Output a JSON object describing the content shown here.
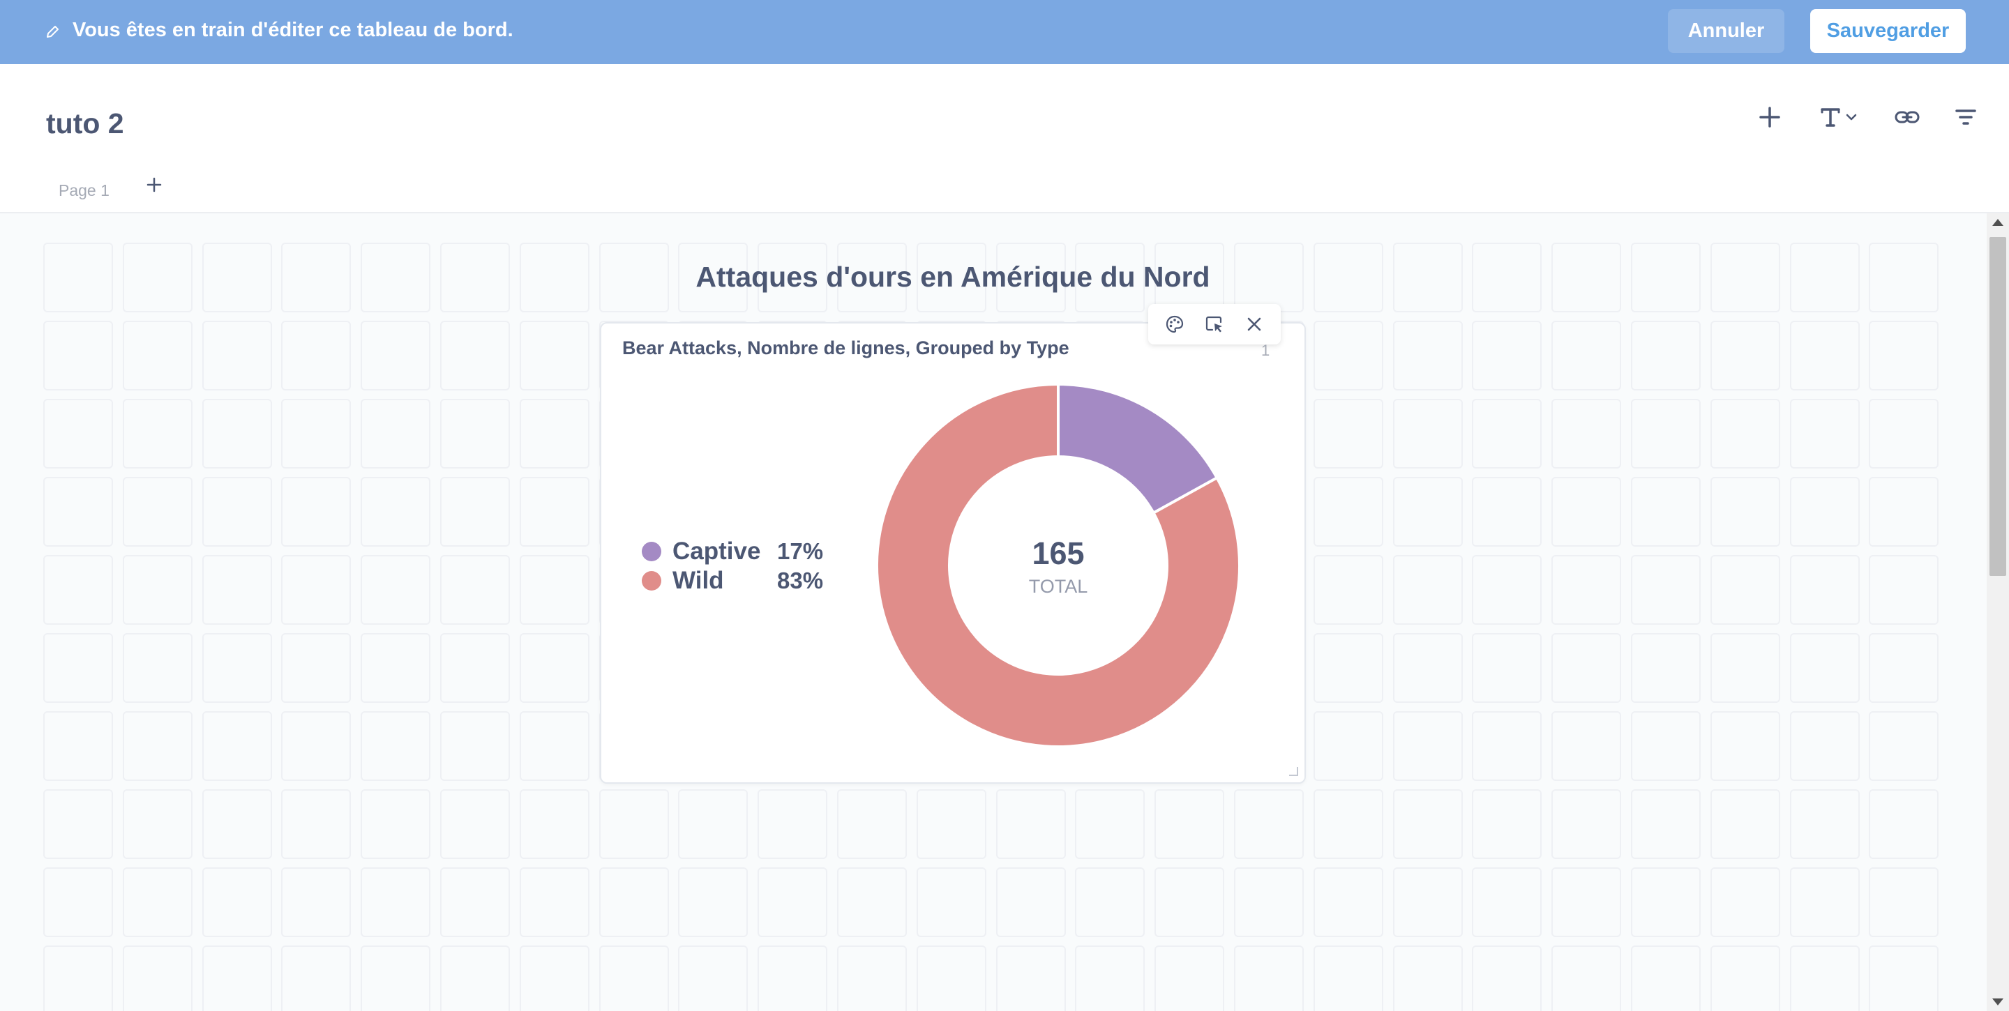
{
  "edit_banner": {
    "message": "Vous êtes en train d'éditer ce tableau de bord.",
    "cancel_label": "Annuler",
    "save_label": "Sauvegarder",
    "background_color": "#7ba8e2",
    "icon": "pencil-icon"
  },
  "header": {
    "title": "tuto 2",
    "tools": [
      {
        "name": "add-question-button",
        "icon": "plus-icon"
      },
      {
        "name": "add-text-button",
        "icon": "text-icon"
      },
      {
        "name": "add-link-button",
        "icon": "link-icon"
      },
      {
        "name": "add-filter-button",
        "icon": "filter-icon"
      }
    ],
    "tabs": [
      {
        "label": "Page 1"
      }
    ],
    "add_tab_icon": "plus-icon"
  },
  "dashboard": {
    "heading": "Attaques d'ours en Amérique du Nord",
    "card": {
      "title": "Bear Attacks, Nombre de lignes, Grouped by Type",
      "badge": "1",
      "actions": [
        "palette-icon",
        "replace-icon",
        "close-icon"
      ],
      "total_value": "165",
      "total_label": "TOTAL",
      "legend": [
        {
          "name": "Captive",
          "percent": "17%"
        },
        {
          "name": "Wild",
          "percent": "83%"
        }
      ]
    }
  },
  "chart_data": {
    "type": "pie",
    "style": "donut",
    "title": "Bear Attacks, Nombre de lignes, Grouped by Type",
    "categories": [
      "Captive",
      "Wild"
    ],
    "values": [
      28,
      137
    ],
    "percentages": [
      17,
      83
    ],
    "colors": [
      "#a48ac4",
      "#e08d8a"
    ],
    "total": 165,
    "legend_position": "left"
  }
}
